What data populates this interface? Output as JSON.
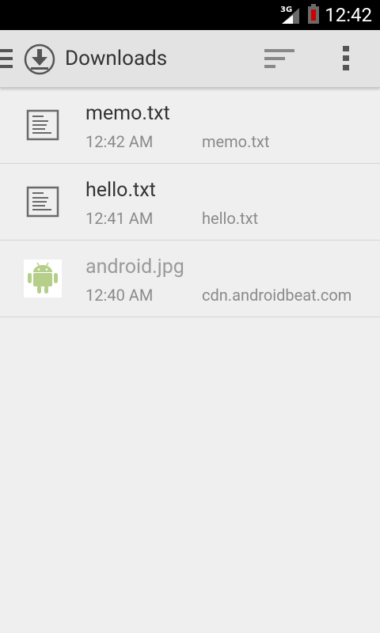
{
  "status_bar": {
    "time": "12:42",
    "network": "3G",
    "battery_color": "#cc0000"
  },
  "action_bar": {
    "title": "Downloads",
    "menu_icon": "hamburger-menu-icon",
    "app_icon": "download-icon",
    "sort_icon": "sort-icon",
    "overflow_icon": "overflow-menu-icon"
  },
  "downloads": [
    {
      "name": "memo.txt",
      "time": "12:42 AM",
      "source": "memo.txt",
      "icon": "text-file-icon"
    },
    {
      "name": "hello.txt",
      "time": "12:41 AM",
      "source": "hello.txt",
      "icon": "text-file-icon"
    },
    {
      "name": "android.jpg",
      "time": "12:40 AM",
      "source": "cdn.androidbeat.com",
      "icon": "android-image-thumbnail"
    }
  ]
}
